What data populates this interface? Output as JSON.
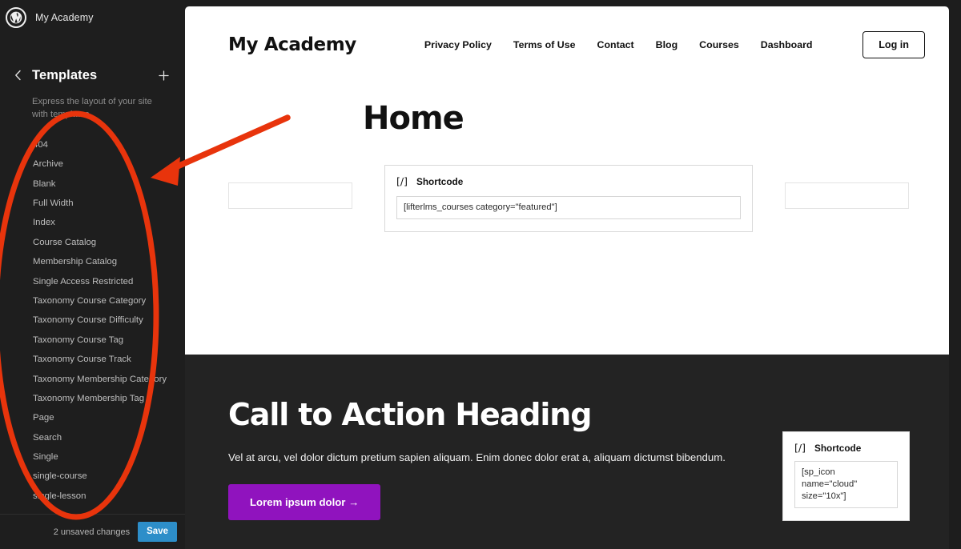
{
  "sidebar": {
    "site_name": "My Academy",
    "wp_icon": "wordpress-logo-icon",
    "back_icon": "chevron-left-icon",
    "panel_title": "Templates",
    "add_icon": "plus-icon",
    "description": "Express the layout of your site with templates.",
    "templates": [
      "404",
      "Archive",
      "Blank",
      "Full Width",
      "Index",
      "Course Catalog",
      "Membership Catalog",
      "Single Access Restricted",
      "Taxonomy Course Category",
      "Taxonomy Course Difficulty",
      "Taxonomy Course Tag",
      "Taxonomy Course Track",
      "Taxonomy Membership Category",
      "Taxonomy Membership Tag",
      "Page",
      "Search",
      "Single",
      "single-course",
      "single-lesson"
    ],
    "footer": {
      "unsaved_label": "2 unsaved changes",
      "save_label": "Save",
      "save_color": "#2d8ec9"
    }
  },
  "canvas": {
    "header": {
      "brand": "My Academy",
      "nav": [
        "Privacy Policy",
        "Terms of Use",
        "Contact",
        "Blog",
        "Courses",
        "Dashboard"
      ],
      "login_label": "Log in"
    },
    "page_title": "Home",
    "blocks": {
      "shortcode_icon": "[/]",
      "shortcode_label": "Shortcode",
      "main_shortcode_value": "[lifterlms_courses category=\"featured\"]",
      "cta_shortcode_value": "[sp_icon name=\"cloud\" size=\"10x\"]"
    },
    "cta": {
      "heading": "Call to Action Heading",
      "subtext": "Vel at arcu, vel dolor dictum pretium sapien aliquam. Enim donec dolor erat a, aliquam dictumst bibendum.",
      "button_label": "Lorem ipsum dolor →",
      "button_color": "#9013be",
      "background": "#232323"
    }
  },
  "annotations": {
    "highlight_color": "#e8340c",
    "ellipse_name": "template-list-highlight-ellipse",
    "arrow_name": "pointer-arrow"
  }
}
